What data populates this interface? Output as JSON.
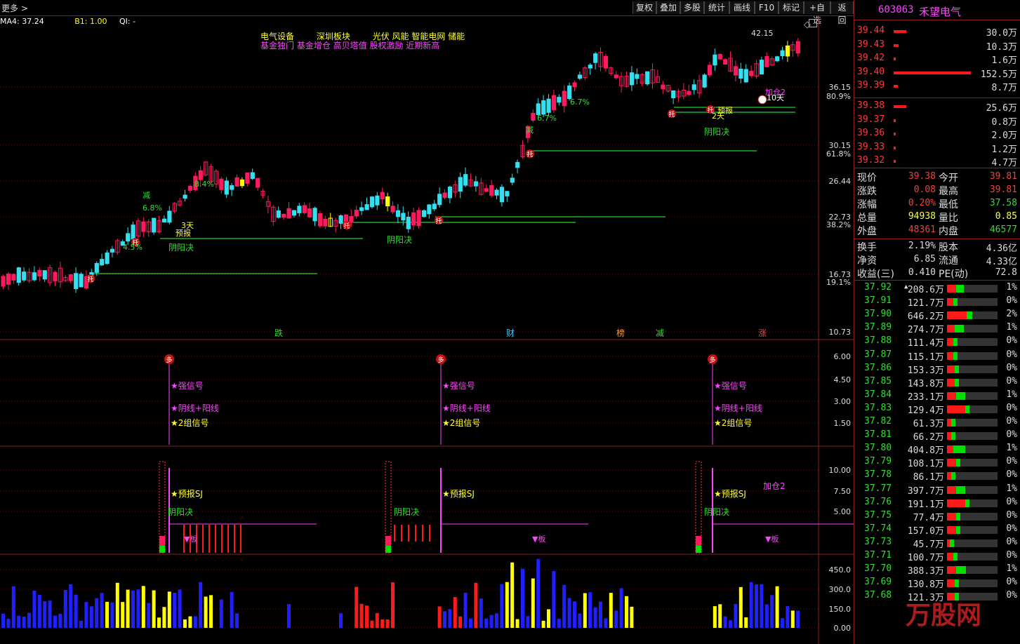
{
  "toolbar": {
    "more_label": "更多 >",
    "buttons": [
      "复权",
      "叠加",
      "多股",
      "统计",
      "画线",
      "F10",
      "标记",
      "+自选",
      "返回"
    ]
  },
  "indicator_line": {
    "ma": "MA4: 37.24",
    "b1": "B1: 1.00",
    "ql": "QI: -"
  },
  "tags_line1": [
    "电气设备",
    "深圳板块",
    "光伏 风能 智能电网 储能"
  ],
  "tags_line2": "基金独门 基金增仓 高贝塔值 股权激励 近期新高",
  "stock": {
    "code": "603063",
    "name": "禾望电气"
  },
  "chart_data": [
    {
      "type": "candlestick",
      "title": "",
      "y_ticks": [
        "36.15",
        "30.15",
        "26.44",
        "22.73",
        "16.73",
        "10.73"
      ],
      "pct_ticks": [
        "80.9%",
        "61.8%",
        "38.2%",
        "19.1%"
      ],
      "peak_label": "42.15",
      "annotations": [
        "3天",
        "预报",
        "阴阳决",
        "托",
        "减",
        "6.8%",
        "8.4%",
        "4.5%",
        "6.7%",
        "2天",
        "预报",
        "10天",
        "加仓2"
      ],
      "bottom_markers": [
        "跌",
        "财",
        "榜",
        "减",
        "涨"
      ]
    },
    {
      "type": "signal",
      "y_ticks": [
        "6.00",
        "4.50",
        "3.00",
        "1.50"
      ],
      "labels": [
        "多",
        "强信号",
        "阴线+阳线",
        "2组信号"
      ]
    },
    {
      "type": "signal",
      "y_ticks": [
        "10.00",
        "7.50",
        "5.00"
      ],
      "labels": [
        "预报SJ",
        "阴阳决",
        "板",
        "加仓2"
      ]
    },
    {
      "type": "bar",
      "y_ticks": [
        "450.0",
        "300.0",
        "150.0",
        "0.00"
      ]
    }
  ],
  "order_book": {
    "asks": [
      {
        "price": "39.44",
        "vol": "30.0万",
        "bar": 0.16
      },
      {
        "price": "39.43",
        "vol": "10.3万",
        "bar": 0.06
      },
      {
        "price": "39.42",
        "vol": "1.6万",
        "bar": 0.01
      },
      {
        "price": "39.40",
        "vol": "152.5万",
        "bar": 1.0
      },
      {
        "price": "39.39",
        "vol": "8.7万",
        "bar": 0.05
      }
    ],
    "bids": [
      {
        "price": "39.38",
        "vol": "25.6万",
        "bar": 0.16
      },
      {
        "price": "39.37",
        "vol": "0.8万",
        "bar": 0.01
      },
      {
        "price": "39.36",
        "vol": "2.0万",
        "bar": 0.02
      },
      {
        "price": "39.33",
        "vol": "1.2万",
        "bar": 0.01
      },
      {
        "price": "39.32",
        "vol": "4.7万",
        "bar": 0.03
      }
    ]
  },
  "quote": [
    {
      "l": "现价",
      "v": "39.38",
      "c": "#ff3b3b",
      "l2": "今开",
      "v2": "39.81",
      "c2": "#ff3b3b"
    },
    {
      "l": "涨跌",
      "v": "0.08",
      "c": "#ff3b3b",
      "l2": "最高",
      "v2": "39.81",
      "c2": "#ff3b3b"
    },
    {
      "l": "涨幅",
      "v": "0.20%",
      "c": "#ff3b3b",
      "l2": "最低",
      "v2": "37.58",
      "c2": "#33dd33"
    },
    {
      "l": "总量",
      "v": "94938",
      "c": "#ffff33",
      "l2": "量比",
      "v2": "0.85",
      "c2": "#ffff33"
    },
    {
      "l": "外盘",
      "v": "48361",
      "c": "#ff3b3b",
      "l2": "内盘",
      "v2": "46577",
      "c2": "#33dd33"
    }
  ],
  "stats": [
    {
      "l": "换手",
      "v": "2.19%",
      "l2": "股本",
      "v2": "4.36亿"
    },
    {
      "l": "净资",
      "v": "6.85",
      "l2": "流通",
      "v2": "4.33亿"
    },
    {
      "l": "收益(三)",
      "v": "0.410",
      "l2": "PE(动)",
      "v2": "72.8"
    }
  ],
  "price_dist": [
    {
      "p": "37.92",
      "v": "208.6万",
      "r": 0.3,
      "g": 0.5,
      "pct": "1%",
      "mark": "▲"
    },
    {
      "p": "37.91",
      "v": "121.7万",
      "r": 0.2,
      "g": 0.0,
      "pct": "0%"
    },
    {
      "p": "37.90",
      "v": "646.2万",
      "r": 0.65,
      "g": 0.35,
      "pct": "2%"
    },
    {
      "p": "37.89",
      "v": "274.7万",
      "r": 0.25,
      "g": 0.6,
      "pct": "1%"
    },
    {
      "p": "37.88",
      "v": "111.4万",
      "r": 0.2,
      "g": 0.0,
      "pct": "0%"
    },
    {
      "p": "37.87",
      "v": "115.1万",
      "r": 0.2,
      "g": 0.0,
      "pct": "0%"
    },
    {
      "p": "37.86",
      "v": "153.3万",
      "r": 0.25,
      "g": 0.0,
      "pct": "0%"
    },
    {
      "p": "37.85",
      "v": "143.8万",
      "r": 0.25,
      "g": 0.0,
      "pct": "0%"
    },
    {
      "p": "37.84",
      "v": "233.1万",
      "r": 0.3,
      "g": 0.6,
      "pct": "1%"
    },
    {
      "p": "37.83",
      "v": "129.4万",
      "r": 0.6,
      "g": 0.0,
      "pct": "0%"
    },
    {
      "p": "37.82",
      "v": "61.3万",
      "r": 0.15,
      "g": 0.0,
      "pct": "0%"
    },
    {
      "p": "37.81",
      "v": "66.2万",
      "r": 0.15,
      "g": 0.0,
      "pct": "0%"
    },
    {
      "p": "37.80",
      "v": "404.8万",
      "r": 0.2,
      "g": 0.8,
      "pct": "1%"
    },
    {
      "p": "37.79",
      "v": "108.1万",
      "r": 0.3,
      "g": 0.3,
      "pct": "0%"
    },
    {
      "p": "37.78",
      "v": "86.1万",
      "r": 0.15,
      "g": 0.0,
      "pct": "0%"
    },
    {
      "p": "37.77",
      "v": "397.7万",
      "r": 0.3,
      "g": 0.6,
      "pct": "1%"
    },
    {
      "p": "37.76",
      "v": "191.1万",
      "r": 0.6,
      "g": 0.0,
      "pct": "0%"
    },
    {
      "p": "37.75",
      "v": "77.4万",
      "r": 0.3,
      "g": 0.0,
      "pct": "0%"
    },
    {
      "p": "37.74",
      "v": "157.0万",
      "r": 0.3,
      "g": 0.0,
      "pct": "0%"
    },
    {
      "p": "37.73",
      "v": "45.7万",
      "r": 0.1,
      "g": 0.0,
      "pct": "0%"
    },
    {
      "p": "37.71",
      "v": "100.7万",
      "r": 0.2,
      "g": 0.0,
      "pct": "0%"
    },
    {
      "p": "37.70",
      "v": "388.3万",
      "r": 0.3,
      "g": 0.65,
      "pct": "1%"
    },
    {
      "p": "37.69",
      "v": "130.8万",
      "r": 0.25,
      "g": 0.0,
      "pct": "0%"
    },
    {
      "p": "37.68",
      "v": "121.3万",
      "r": 0.25,
      "g": 0.0,
      "pct": "0%"
    }
  ],
  "colors": {
    "up": "#ff1a5e",
    "down": "#33e0f0",
    "yellow": "#ffff00",
    "green": "#00e000",
    "accent_red": "#8a2020"
  }
}
